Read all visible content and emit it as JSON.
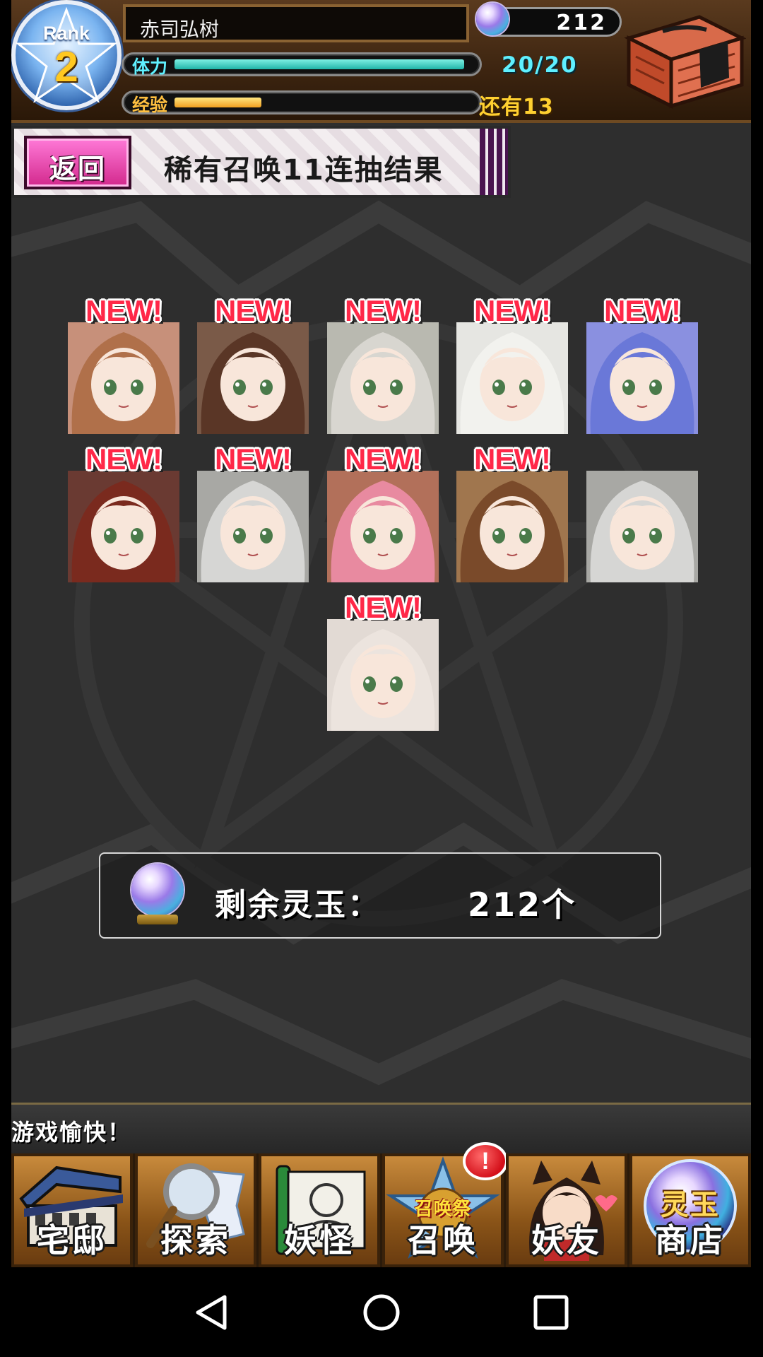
{
  "header": {
    "rank_label": "Rank",
    "rank_value": "2",
    "player_name": "赤司弘树",
    "stamina_label": "体力",
    "stamina_value": 1.0,
    "stamina_text": "20/20",
    "exp_label": "经验",
    "exp_value": 0.3,
    "exp_remaining": "还有13",
    "gem_count": "212"
  },
  "banner": {
    "back_label": "返回",
    "title": "稀有召唤11连抽结果"
  },
  "results": {
    "badge_text": "NEW!",
    "cards": [
      {
        "portrait": "brown-haired-girl-with-monocle",
        "is_new": true,
        "hair": "#b0704a",
        "bg": "#c7907a"
      },
      {
        "portrait": "dark-brown-haired-girl-with-cat-ears",
        "is_new": true,
        "hair": "#5a3626",
        "bg": "#7a5a48"
      },
      {
        "portrait": "white-haired-girl-in-green",
        "is_new": true,
        "hair": "#d8d6d0",
        "bg": "#b9b9b0"
      },
      {
        "portrait": "girl-in-white-hood",
        "is_new": true,
        "hair": "#f2f2ee",
        "bg": "#e6e6e2"
      },
      {
        "portrait": "blue-haired-fox-girl",
        "is_new": true,
        "hair": "#6a78d8",
        "bg": "#8a90e0"
      },
      {
        "portrait": "red-brown-haired-girl",
        "is_new": true,
        "hair": "#7a2a1e",
        "bg": "#6a3a32"
      },
      {
        "portrait": "silver-haired-frog-girl",
        "is_new": true,
        "hair": "#d6d6d4",
        "bg": "#a8a8a4"
      },
      {
        "portrait": "pink-haired-girl-with-glasses",
        "is_new": true,
        "hair": "#e88aa0",
        "bg": "#b2705a"
      },
      {
        "portrait": "brown-bob-haired-girl",
        "is_new": true,
        "hair": "#7a4a2a",
        "bg": "#a0764e"
      },
      {
        "portrait": "silver-haired-frog-girl-duplicate",
        "is_new": false,
        "hair": "#d6d6d4",
        "bg": "#a8a8a4"
      },
      {
        "portrait": "pale-girl-in-white-hood",
        "is_new": true,
        "hair": "#ece4de",
        "bg": "#e2dad4"
      }
    ]
  },
  "remaining": {
    "label": "剩余灵玉：",
    "value": "212个"
  },
  "ticker": {
    "text": "游戏愉快！"
  },
  "nav": {
    "items": [
      {
        "label": "宅邸",
        "icon": "mansion-icon"
      },
      {
        "label": "探索",
        "icon": "magnifier-map-icon"
      },
      {
        "label": "妖怪",
        "icon": "scroll-icon"
      },
      {
        "label": "召唤",
        "icon": "star-summon-icon",
        "badge": "!",
        "subtitle": "召唤祭"
      },
      {
        "label": "妖友",
        "icon": "friend-girl-icon"
      },
      {
        "label": "商店",
        "icon": "jade-orb-icon",
        "subtitle": "灵玉"
      }
    ]
  },
  "colors": {
    "stamina": "#20c4b4",
    "exp": "#f0a020",
    "new_badge": "#ff2848",
    "back_button": "#e040b0"
  }
}
